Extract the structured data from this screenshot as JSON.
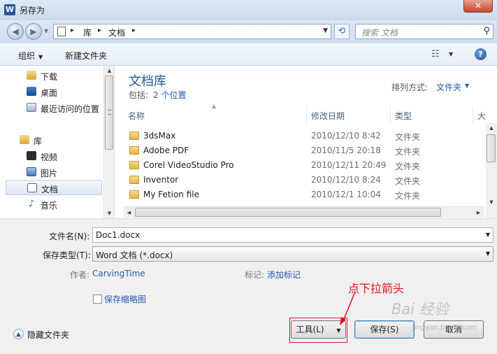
{
  "window": {
    "title": "另存为",
    "app_icon": "W",
    "close": "✕"
  },
  "address": {
    "crumbs": [
      "库",
      "文档"
    ],
    "search_placeholder": "搜索 文档"
  },
  "toolbar": {
    "organize": "组织",
    "new_folder": "新建文件夹",
    "help": "?"
  },
  "nav": {
    "items": [
      {
        "label": "下载"
      },
      {
        "label": "桌面"
      },
      {
        "label": "最近访问的位置"
      },
      {
        "label": "库"
      },
      {
        "label": "视频"
      },
      {
        "label": "图片"
      },
      {
        "label": "文档",
        "selected": true
      },
      {
        "label": "音乐"
      }
    ]
  },
  "library": {
    "title": "文档库",
    "includes_label": "包括:",
    "includes_link": "2 个位置",
    "arrange_label": "排列方式:",
    "arrange_value": "文件夹"
  },
  "columns": {
    "name": "名称",
    "date": "修改日期",
    "type": "类型",
    "size": "大"
  },
  "files": [
    {
      "name": "3dsMax",
      "date": "2010/12/10 8:42",
      "type": "文件夹"
    },
    {
      "name": "Adobe PDF",
      "date": "2010/11/5 20:18",
      "type": "文件夹"
    },
    {
      "name": "Corel VideoStudio Pro",
      "date": "2010/12/11 20:49",
      "type": "文件夹"
    },
    {
      "name": "Inventor",
      "date": "2010/12/10 8:24",
      "type": "文件夹"
    },
    {
      "name": "My Fetion file",
      "date": "2010/12/1 10:04",
      "type": "文件夹"
    }
  ],
  "form": {
    "filename_label": "文件名(N):",
    "filename_value": "Doc1.docx",
    "filetype_label": "保存类型(T):",
    "filetype_value": "Word 文档 (*.docx)",
    "author_label": "作者:",
    "author_value": "CarvingTime",
    "tags_label": "标记:",
    "tags_value": "添加标记",
    "thumbnail_label": "保存缩略图",
    "hide_folders": "隐藏文件夹"
  },
  "buttons": {
    "tools": "工具(L)",
    "save": "保存(S)",
    "cancel": "取消"
  },
  "annotation": {
    "text": "点下拉箭头",
    "color": "#e0101a"
  },
  "watermark": {
    "text": "Bai 经验",
    "url": "jingyan.baidu.com"
  }
}
